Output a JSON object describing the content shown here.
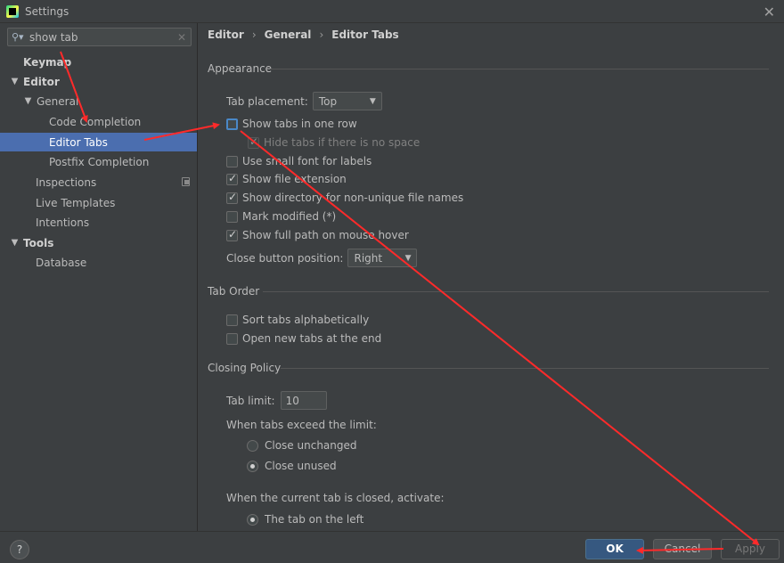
{
  "window": {
    "title": "Settings"
  },
  "sidebar": {
    "search": {
      "value": "show tab"
    },
    "items": [
      {
        "label": "Keymap"
      },
      {
        "label": "Editor"
      },
      {
        "label": "General"
      },
      {
        "label": "Code Completion"
      },
      {
        "label": "Editor Tabs"
      },
      {
        "label": "Postfix Completion"
      },
      {
        "label": "Inspections"
      },
      {
        "label": "Live Templates"
      },
      {
        "label": "Intentions"
      },
      {
        "label": "Tools"
      },
      {
        "label": "Database"
      }
    ]
  },
  "breadcrumb": [
    "Editor",
    "General",
    "Editor Tabs"
  ],
  "appearance": {
    "title": "Appearance",
    "tab_placement": {
      "label": "Tab placement:",
      "value": "Top"
    },
    "show_tabs_one_row": {
      "label": "Show tabs in one row",
      "checked": false
    },
    "hide_tabs_no_space": {
      "label": "Hide tabs if there is no space",
      "checked": true,
      "disabled": true
    },
    "small_font": {
      "label": "Use small font for labels",
      "checked": false
    },
    "file_extension": {
      "label": "Show file extension",
      "checked": true
    },
    "directory_non_unique": {
      "label": "Show directory for non-unique file names",
      "checked": true
    },
    "mark_modified": {
      "label": "Mark modified (*)",
      "checked": false
    },
    "full_path_hover": {
      "label": "Show full path on mouse hover",
      "checked": true
    },
    "close_button_position": {
      "label": "Close button position:",
      "value": "Right"
    }
  },
  "tab_order": {
    "title": "Tab Order",
    "sort_alphabetically": {
      "label": "Sort tabs alphabetically",
      "checked": false
    },
    "open_at_end": {
      "label": "Open new tabs at the end",
      "checked": false
    }
  },
  "closing_policy": {
    "title": "Closing Policy",
    "tab_limit": {
      "label": "Tab limit:",
      "value": "10"
    },
    "exceed_label": "When tabs exceed the limit:",
    "close_unchanged": {
      "label": "Close unchanged",
      "selected": false
    },
    "close_unused": {
      "label": "Close unused",
      "selected": true
    },
    "closed_activate_label": "When the current tab is closed, activate:",
    "tab_on_left": {
      "label": "The tab on the left",
      "selected": true
    }
  },
  "footer": {
    "help": "?",
    "ok": "OK",
    "cancel": "Cancel",
    "apply": "Apply"
  },
  "colors": {
    "selection": "#4b6eaf",
    "annotation": "#ff2a2a",
    "primary_button": "#365880"
  }
}
